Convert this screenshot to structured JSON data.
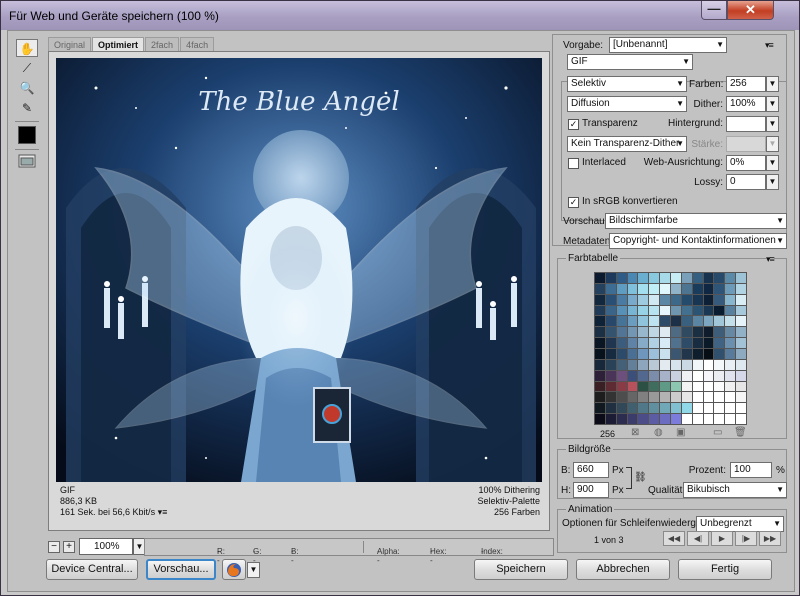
{
  "window": {
    "title": "Für Web und Geräte speichern (100 %)",
    "close_glyph": "✕",
    "minimize_glyph": "—"
  },
  "tools": {
    "hand_glyph": "✋",
    "slice_glyph": "⟋",
    "zoom_glyph": "🔍",
    "eyedropper_glyph": "✎",
    "color_swatch": "#000000"
  },
  "tabs": [
    "Original",
    "Optimiert",
    "2fach",
    "4fach"
  ],
  "preview": {
    "image_title": "The Blue Angel",
    "info_left": [
      "GIF",
      "886,3 KB",
      "161 Sek. bei 56,6 Kbit/s"
    ],
    "info_menu": "▾≡",
    "info_right": [
      "100% Dithering",
      "Selektiv-Palette",
      "256 Farben"
    ]
  },
  "zoom": {
    "minus": "−",
    "plus": "+",
    "value": "100%",
    "readouts": [
      {
        "label": "R:",
        "value": "--"
      },
      {
        "label": "G:",
        "value": "--"
      },
      {
        "label": "B:",
        "value": "--"
      },
      {
        "label": "Alpha:",
        "value": "--"
      },
      {
        "label": "Hex:",
        "value": "--"
      },
      {
        "label": "Index:",
        "value": "--"
      }
    ]
  },
  "settings": {
    "vorgabe_label": "Vorgabe:",
    "vorgabe_value": "[Unbenannt]",
    "panel_menu": "▾≡",
    "format": "GIF",
    "reduction": "Selektiv",
    "farben_label": "Farben:",
    "farben_value": "256",
    "dither_algo": "Diffusion",
    "dither_label": "Dither:",
    "dither_value": "100%",
    "transparency_label": "Transparenz",
    "transparency_checked": "✓",
    "matte_label": "Hintergrund:",
    "transparency_dither": "Kein Transparenz-Dither",
    "amount_label": "Stärke:",
    "interlaced_label": "Interlaced",
    "websnap_label": "Web-Ausrichtung:",
    "websnap_value": "0%",
    "lossy_label": "Lossy:",
    "lossy_value": "0",
    "srgb_label": "In sRGB konvertieren",
    "srgb_checked": "✓",
    "preview_label": "Vorschau:",
    "preview_value": "Bildschirmfarbe",
    "metadata_label": "Metadaten:",
    "metadata_value": "Copyright- und Kontaktinformationen"
  },
  "color_table": {
    "title": "Farbtabelle",
    "menu": "▾≡",
    "count": "256",
    "swatches": [
      "#0b1a2e",
      "#1d3a5c",
      "#2f5c86",
      "#4a87b2",
      "#6aaed0",
      "#89c9e0",
      "#a7dbe9",
      "#c6ecf4",
      "#7a9fb8",
      "#355f80",
      "#16324f",
      "#27496a",
      "#5b8aa9",
      "#9cc3d6",
      "#24425f",
      "#3d6d93",
      "#5e9cc2",
      "#7fc0dc",
      "#a3dfee",
      "#c0eef6",
      "#e0f8fb",
      "#8fb3c9",
      "#4d7592",
      "#1a3c5c",
      "#0f2742",
      "#2e5577",
      "#6b9bb8",
      "#b0d4e3",
      "#12283f",
      "#2a4f74",
      "#4a7ca3",
      "#7aaacb",
      "#9fcbe0",
      "#cfe8f1",
      "#5c88a6",
      "#3c6889",
      "#244a6c",
      "#183654",
      "#0d2036",
      "#355a7b",
      "#88b6ce",
      "#d8edf4",
      "#1f3b58",
      "#3a6488",
      "#5891b8",
      "#78b4d3",
      "#98d2e6",
      "#b6e3ef",
      "#e7f6fa",
      "#6f96b0",
      "#43708f",
      "#2b5373",
      "#1a3753",
      "#0a1c30",
      "#58819f",
      "#a5c9da",
      "#0e2238",
      "#27486a",
      "#467398",
      "#6a9dbf",
      "#90c4dc",
      "#bde3f0",
      "#2d4a66",
      "#1c3147",
      "#39607f",
      "#5a86a4",
      "#7da7c1",
      "#a0c6d8",
      "#c3e0ea",
      "#e6f3f8",
      "#1b2f45",
      "#34536f",
      "#527596",
      "#7396b4",
      "#98b7cd",
      "#bfd6e3",
      "#dfe9f0",
      "#4f6b83",
      "#2f4a61",
      "#1a2f42",
      "#0e1c2b",
      "#3e5d79",
      "#6688a3",
      "#93b1c6",
      "#0a1624",
      "#1f3550",
      "#3c5c7e",
      "#5f83a6",
      "#86abc9",
      "#b0d0e4",
      "#d6ebf5",
      "#50728f",
      "#2e4c67",
      "#182d41",
      "#0b1a28",
      "#406384",
      "#6b8fae",
      "#a4c2d6",
      "#08121d",
      "#162a40",
      "#2c4a6a",
      "#4a6f95",
      "#6f97bd",
      "#9cbfdc",
      "#c9e0ef",
      "#3a5670",
      "#21364b",
      "#0f1e2d",
      "#060d15",
      "#31506d",
      "#587b9b",
      "#8daac0",
      "#16283a",
      "#2a4258",
      "#445f78",
      "#647f99",
      "#8ea6bd",
      "#bac9d6",
      "#e3ebf1",
      "#d7e3ec",
      "#cbd9e4",
      "#f1f6f9",
      "#ffffff",
      "#f4f8fb",
      "#e9f0f5",
      "#dde8ef",
      "#2d2038",
      "#4a3558",
      "#6c4f7c",
      "#3b4f7a",
      "#53688f",
      "#7c8cab",
      "#a7b2c9",
      "#c9d0e0",
      "#eef0f6",
      "#ffffff",
      "#f7f7fb",
      "#ececf3",
      "#e0e2ee",
      "#d4d8e8",
      "#3a1f24",
      "#5e2b33",
      "#8a3c46",
      "#b7525c",
      "#2c5044",
      "#3f6e5f",
      "#5e9a86",
      "#8cc7b1",
      "#f3f3f3",
      "#ffffff",
      "#ffffff",
      "#fbfbfb",
      "#f0f0f0",
      "#e5e5e5",
      "#1d1d1d",
      "#333333",
      "#4d4d4d",
      "#666666",
      "#808080",
      "#999999",
      "#b3b3b3",
      "#cccccc",
      "#e6e6e6",
      "#ffffff",
      "#ffffff",
      "#ffffff",
      "#ffffff",
      "#f5f5f5",
      "#101820",
      "#203040",
      "#304858",
      "#406070",
      "#507888",
      "#6090a0",
      "#70a8b8",
      "#80c0d0",
      "#90d8e8",
      "#ffffff",
      "#ffffff",
      "#ffffff",
      "#ffffff",
      "#ffffff",
      "#0c0c18",
      "#1c1c34",
      "#2c2c50",
      "#3c3c6c",
      "#4c4c88",
      "#5c5ca4",
      "#6c6cc0",
      "#7c7cdc",
      "#ffffff",
      "#ffffff",
      "#ffffff",
      "#ffffff",
      "#ffffff",
      "#ffffff"
    ]
  },
  "image_size": {
    "title": "Bildgröße",
    "b_label": "B:",
    "b_value": "660",
    "h_label": "H:",
    "h_value": "900",
    "unit": "Px",
    "percent_label": "Prozent:",
    "percent_value": "100",
    "percent_unit": "%",
    "quality_label": "Qualität:",
    "quality_value": "Bikubisch"
  },
  "animation": {
    "title": "Animation",
    "loop_label": "Optionen für Schleifenwiedergabe:",
    "loop_value": "Unbegrenzt",
    "frame_counter": "1 von 3",
    "controls": [
      "◀◀",
      "◀|",
      "▶",
      "|▶",
      "▶▶"
    ]
  },
  "buttons": {
    "device_central": "Device Central...",
    "preview": "Vorschau...",
    "save": "Speichern",
    "cancel": "Abbrechen",
    "done": "Fertig"
  }
}
